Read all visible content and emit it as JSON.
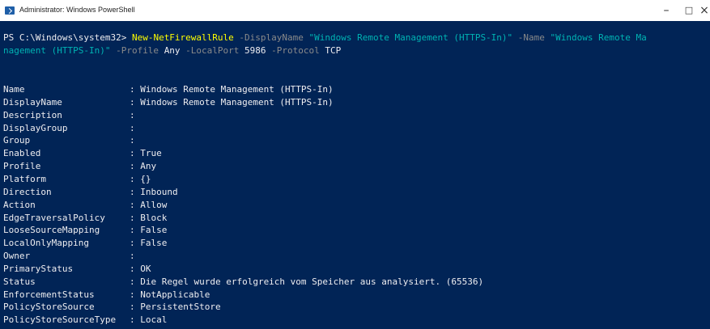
{
  "window": {
    "title": "Administrator: Windows PowerShell",
    "minimize": "–",
    "maximize": "□",
    "close": "×"
  },
  "command": {
    "prompt": "PS C:\\Windows\\system32> ",
    "cmdlet": "New-NetFirewallRule",
    "p1": " -DisplayName ",
    "v1": "\"Windows Remote Management (HTTPS-In)\"",
    "p2": " -Name ",
    "v2a": "\"Windows Remote Ma",
    "v2b": "nagement (HTTPS-In)\"",
    "p3": " -Profile ",
    "v3": "Any",
    "p4": " -LocalPort ",
    "v4": "5986",
    "p5": " -Protocol ",
    "v5": "TCP"
  },
  "output": [
    {
      "name": "Name",
      "value": ": Windows Remote Management (HTTPS-In)"
    },
    {
      "name": "DisplayName",
      "value": ": Windows Remote Management (HTTPS-In)"
    },
    {
      "name": "Description",
      "value": ":"
    },
    {
      "name": "DisplayGroup",
      "value": ":"
    },
    {
      "name": "Group",
      "value": ":"
    },
    {
      "name": "Enabled",
      "value": ": True"
    },
    {
      "name": "Profile",
      "value": ": Any"
    },
    {
      "name": "Platform",
      "value": ": {}"
    },
    {
      "name": "Direction",
      "value": ": Inbound"
    },
    {
      "name": "Action",
      "value": ": Allow"
    },
    {
      "name": "EdgeTraversalPolicy",
      "value": ": Block"
    },
    {
      "name": "LooseSourceMapping",
      "value": ": False"
    },
    {
      "name": "LocalOnlyMapping",
      "value": ": False"
    },
    {
      "name": "Owner",
      "value": ":"
    },
    {
      "name": "PrimaryStatus",
      "value": ": OK"
    },
    {
      "name": "Status",
      "value": ": Die Regel wurde erfolgreich vom Speicher aus analysiert. (65536)"
    },
    {
      "name": "EnforcementStatus",
      "value": ": NotApplicable"
    },
    {
      "name": "PolicyStoreSource",
      "value": ": PersistentStore"
    },
    {
      "name": "PolicyStoreSourceType",
      "value": ": Local"
    }
  ]
}
